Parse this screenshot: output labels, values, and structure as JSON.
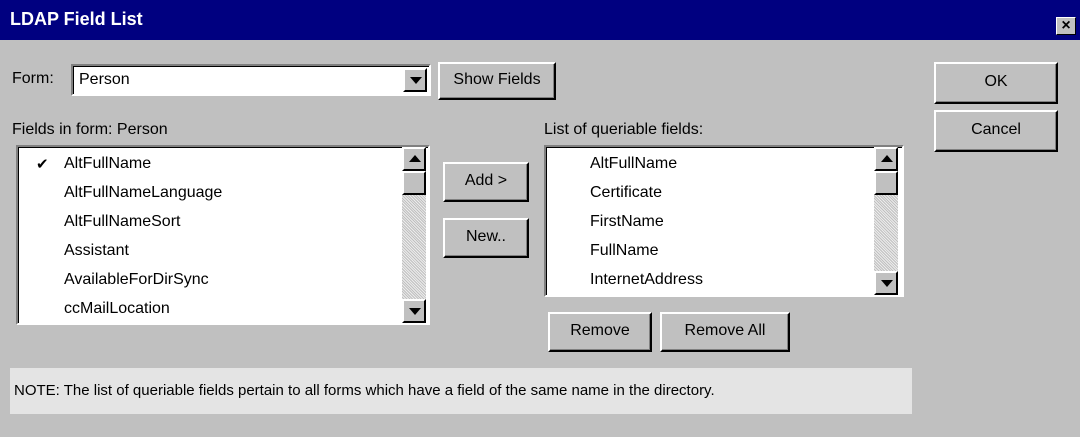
{
  "window": {
    "title": "LDAP Field List",
    "close_glyph": "×"
  },
  "form": {
    "label": "Form:",
    "selected": "Person",
    "show_fields_label": "Show Fields"
  },
  "fields_panel": {
    "label": "Fields in form: Person",
    "items": [
      {
        "name": "AltFullName",
        "checked": true
      },
      {
        "name": "AltFullNameLanguage",
        "checked": false
      },
      {
        "name": "AltFullNameSort",
        "checked": false
      },
      {
        "name": "Assistant",
        "checked": false
      },
      {
        "name": "AvailableForDirSync",
        "checked": false
      },
      {
        "name": "ccMailLocation",
        "checked": false
      }
    ],
    "check_glyph": "✔"
  },
  "actions": {
    "add_label": "Add >",
    "new_label": "New.."
  },
  "queriable_panel": {
    "label": "List of queriable fields:",
    "items": [
      "AltFullName",
      "Certificate",
      "FirstName",
      "FullName",
      "InternetAddress"
    ],
    "remove_label": "Remove",
    "remove_all_label": "Remove All"
  },
  "dialog_buttons": {
    "ok_label": "OK",
    "cancel_label": "Cancel"
  },
  "note": "NOTE: The list of queriable fields pertain to all forms which have a field of the same name in the directory.",
  "colors": {
    "titlebar": "#000080",
    "face": "#c0c0c0",
    "note_bg": "#e4e4e4"
  },
  "icons": {
    "close": "close-icon",
    "dropdown": "chevron-down-icon",
    "scroll_up": "scroll-up-arrow-icon",
    "scroll_down": "scroll-down-arrow-icon",
    "check": "checkmark-icon"
  }
}
